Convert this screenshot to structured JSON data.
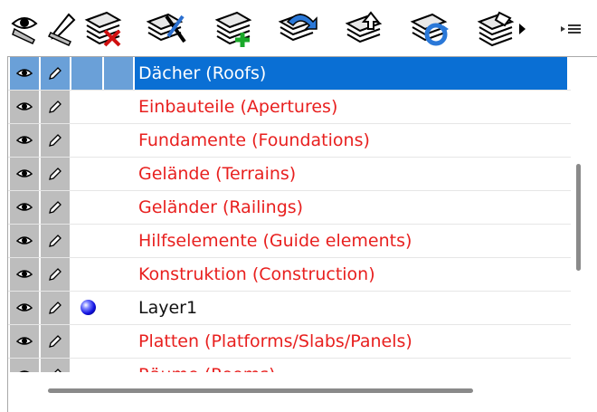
{
  "toolbar": {
    "buttons": [
      {
        "name": "show-all-button",
        "icon": "eye-icon"
      },
      {
        "name": "edit-all-button",
        "icon": "pencil-icon"
      },
      {
        "name": "delete-layer-button",
        "icon": "delete-layer-icon"
      },
      {
        "name": "layer-properties-button",
        "icon": "layer-tools-icon"
      },
      {
        "name": "new-layer-button",
        "icon": "add-layer-icon"
      },
      {
        "name": "undo-layer-button",
        "icon": "layer-undo-icon"
      },
      {
        "name": "move-layer-up-button",
        "icon": "layer-up-icon"
      },
      {
        "name": "refresh-layers-button",
        "icon": "layer-refresh-icon"
      },
      {
        "name": "layer-menu-button",
        "icon": "layer-dropdown-icon"
      },
      {
        "name": "options-menu-button",
        "icon": "menu-lines-icon"
      }
    ]
  },
  "layers": [
    {
      "name": "Dächer (Roofs)",
      "selected": true,
      "color": "#ffffff"
    },
    {
      "name": "Einbauteile (Apertures)",
      "color": "#e8201f"
    },
    {
      "name": "Fundamente (Foundations)",
      "color": "#e8201f"
    },
    {
      "name": "Gelände (Terrains)",
      "color": "#e8201f"
    },
    {
      "name": "Geländer (Railings)",
      "color": "#e8201f"
    },
    {
      "name": "Hilfselemente (Guide elements)",
      "color": "#e8201f"
    },
    {
      "name": "Konstruktion (Construction)",
      "color": "#e8201f"
    },
    {
      "name": "Layer1",
      "active": true,
      "color": "#111111"
    },
    {
      "name": "Platten (Platforms/Slabs/Panels)",
      "color": "#e8201f"
    },
    {
      "name": "Räume (Rooms)",
      "color": "#e8201f"
    }
  ],
  "colors": {
    "selection": "#0a6fd4",
    "selection_light": "#6aa0d8",
    "locked_red": "#e8201f",
    "cell_gray": "#bdbdbd"
  }
}
